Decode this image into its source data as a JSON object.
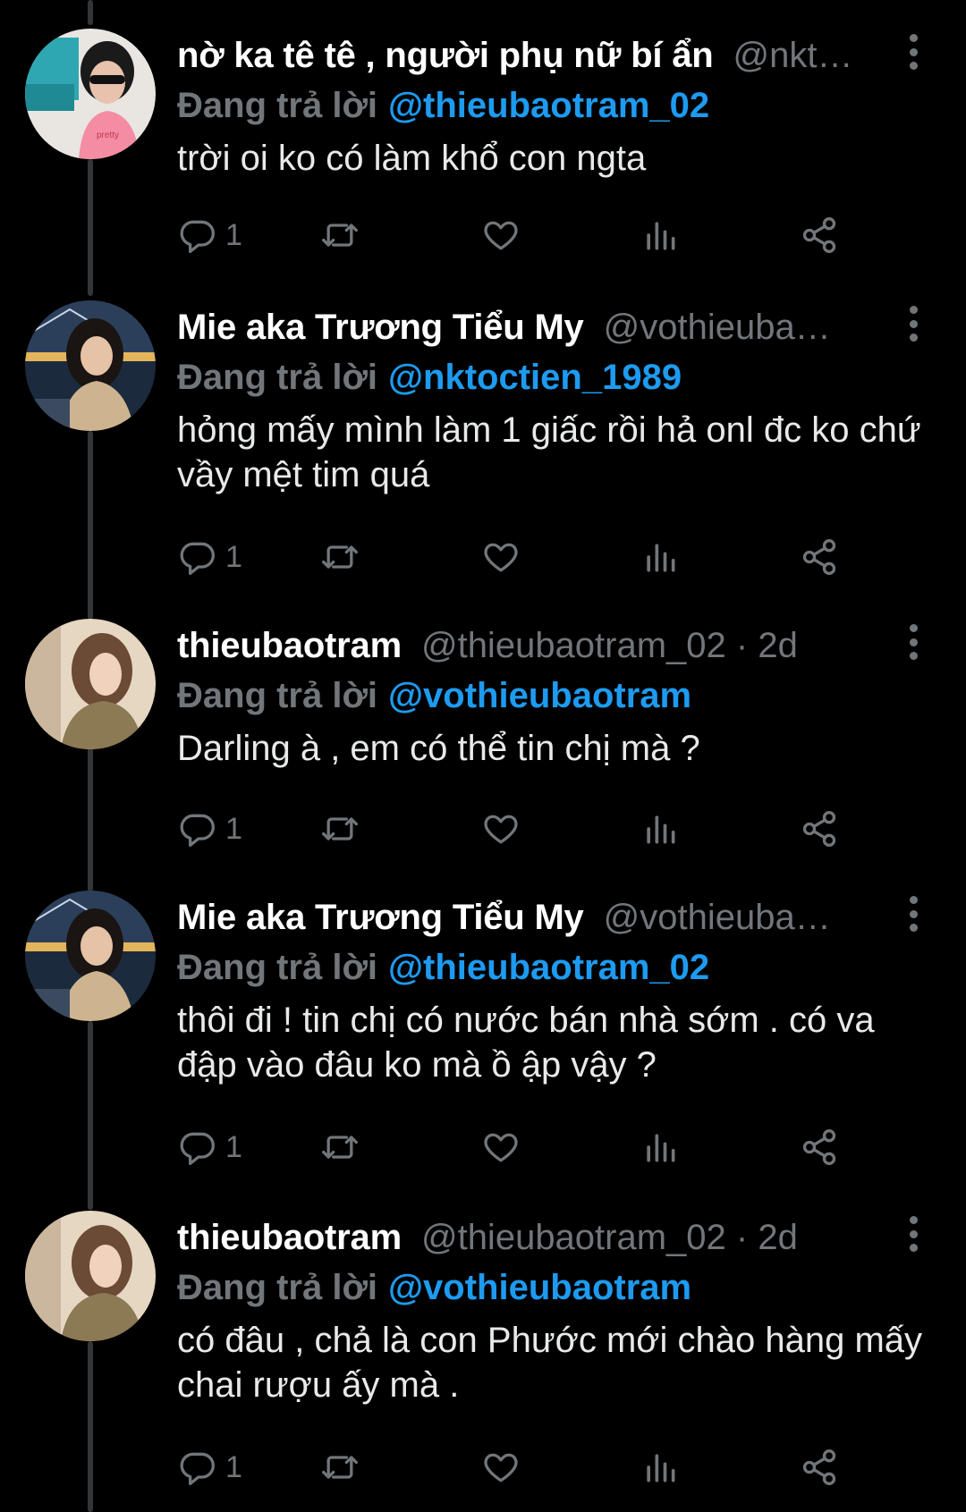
{
  "tweets": [
    {
      "name": "nờ ka tê tê , người phụ nữ bí ẩn",
      "handle": "@nkt…",
      "reply_prefix": "Đang trả lời",
      "reply_to": "@thieubaotram_02",
      "text": "trời oi ko có làm khổ con ngta",
      "reply_count": "1"
    },
    {
      "name": "Mie aka Trương Tiểu My",
      "handle": "@vothieuba…",
      "reply_prefix": "Đang trả lời",
      "reply_to": "@nktoctien_1989",
      "text": "hỏng mấy mình làm 1 giấc rồi hả onl đc ko chứ vầy mệt tim quá",
      "reply_count": "1"
    },
    {
      "name": "thieubaotram",
      "handle": "@thieubaotram_02 · 2d",
      "reply_prefix": "Đang trả lời",
      "reply_to": "@vothieubaotram",
      "text": "Darling à , em có thể tin chị mà ?",
      "reply_count": "1"
    },
    {
      "name": "Mie aka Trương Tiểu My",
      "handle": "@vothieuba…",
      "reply_prefix": "Đang trả lời",
      "reply_to": "@thieubaotram_02",
      "text": "thôi đi ! tin chị có nước bán nhà sớm . có va đập vào đâu ko mà ồ ập vậy ?",
      "reply_count": "1"
    },
    {
      "name": "thieubaotram",
      "handle": "@thieubaotram_02 · 2d",
      "reply_prefix": "Đang trả lời",
      "reply_to": "@vothieubaotram",
      "text": "có đâu , chả là con Phước mới chào hàng mấy chai rượu ấy mà .",
      "reply_count": "1"
    }
  ],
  "icons": {
    "reply": "reply-icon",
    "retweet": "retweet-icon",
    "like": "heart-icon",
    "views": "views-chart-icon",
    "share": "share-icon",
    "more": "more-vertical-icon"
  },
  "colors": {
    "background": "#000000",
    "name": "#ffffff",
    "secondary": "#71767b",
    "link": "#1d9bf0",
    "body_text": "#e7e9ea",
    "thread_line": "#333639"
  }
}
